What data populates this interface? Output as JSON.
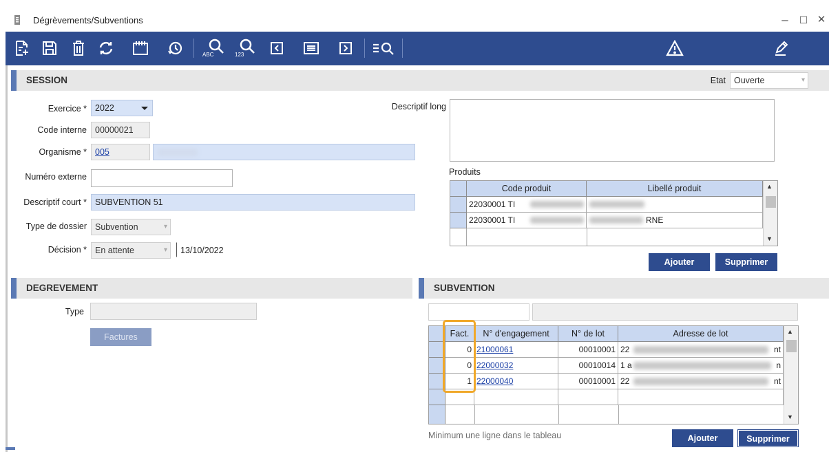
{
  "window": {
    "title": "Dégrèvements/Subventions",
    "controls": [
      "–",
      "☐",
      "✕"
    ]
  },
  "toolbar": {
    "icons": [
      "new-record-icon",
      "save-icon",
      "delete-icon",
      "refresh-icon",
      "calendar-icon",
      "history-icon",
      "search-text-icon",
      "search-number-icon",
      "previous-icon",
      "list-view-icon",
      "next-icon",
      "filter-search-icon",
      "warning-icon",
      "edit-note-icon"
    ],
    "search_text_sub": "ABC",
    "search_number_sub": "123"
  },
  "session": {
    "title": "SESSION",
    "etat_label": "Etat",
    "etat_value": "Ouverte",
    "exercice_label": "Exercice *",
    "exercice_value": "2022",
    "code_interne_label": "Code interne",
    "code_interne_value": "00000021",
    "organisme_label": "Organisme *",
    "organisme_code": "005",
    "numero_externe_label": "Numéro externe",
    "numero_externe_value": "",
    "descriptif_court_label": "Descriptif court *",
    "descriptif_court_value": "SUBVENTION 51",
    "type_dossier_label": "Type de dossier",
    "type_dossier_value": "Subvention",
    "decision_label": "Décision *",
    "decision_value": "En attente",
    "decision_date": "13/10/2022",
    "descriptif_long_label": "Descriptif long",
    "descriptif_long_value": ""
  },
  "produits": {
    "label": "Produits",
    "columns": [
      "Code produit",
      "Libellé produit"
    ],
    "rows": [
      {
        "code": "22030001 TI",
        "libelle": ""
      },
      {
        "code": "22030001 TI",
        "libelle": "RNE"
      }
    ],
    "add_label": "Ajouter",
    "delete_label": "Supprimer"
  },
  "degrevement": {
    "title": "DEGREVEMENT",
    "type_label": "Type",
    "type_value": "",
    "factures_label": "Factures"
  },
  "subvention": {
    "title": "SUBVENTION",
    "columns": [
      "Fact.",
      "N° d'engagement",
      "N° de lot",
      "Adresse de lot"
    ],
    "rows": [
      {
        "fact": "0",
        "engagement": "21000061",
        "lot": "00010001",
        "adresse": "22",
        "adresse_end": "nt"
      },
      {
        "fact": "0",
        "engagement": "22000032",
        "lot": "00010014",
        "adresse": "1 a",
        "adresse_end": "n"
      },
      {
        "fact": "1",
        "engagement": "22000040",
        "lot": "00010001",
        "adresse": "22",
        "adresse_end": "nt"
      }
    ],
    "hint": "Minimum une ligne dans le tableau",
    "add_label": "Ajouter",
    "delete_label": "Supprimer"
  },
  "colors": {
    "accent": "#2e4c8f",
    "header_blue": "#c9d8f1",
    "highlight": "#f0a82a",
    "section_bar": "#5a79b4"
  }
}
